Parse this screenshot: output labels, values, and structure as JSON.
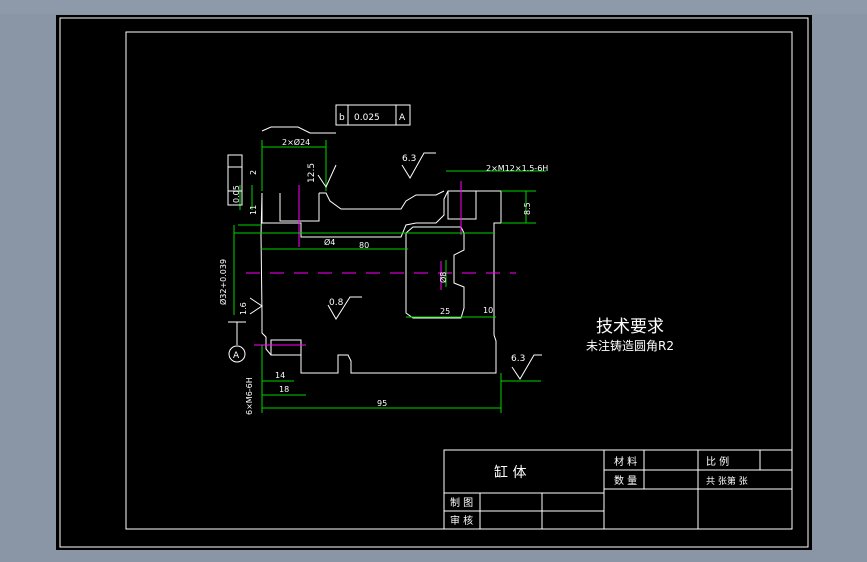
{
  "drawing": {
    "tech_title": "技术要求",
    "tech_note": "未注铸造圆角R2",
    "tolerance_frame": {
      "symbol": "b",
      "value": "0.025",
      "datum": "A"
    },
    "side_frame": {
      "symbol": "⊥",
      "value": "0.05",
      "datum": "A"
    },
    "datum_label": "A",
    "dims": {
      "holes_top_left": "2×Ø24",
      "thread_top_right": "2×M12×1.5-6H",
      "rough_1": "6.3",
      "rough_2": "12.5",
      "rough_3": "0.8",
      "rough_4": "6.3",
      "rough_5": "1.6",
      "d4": "Ø4",
      "len80": "80",
      "d8": "Ø8",
      "len25": "25",
      "len10": "10",
      "len95": "95",
      "len14": "14",
      "len18": "18",
      "h8_5": "8.5",
      "h2": "2",
      "h11": "11",
      "bore": "Ø32+0.039",
      "thread_left": "6×M6-6H"
    }
  },
  "title_block": {
    "part_name": "缸 体",
    "material_label": "材 料",
    "scale_label": "比 例",
    "qty_label": "数 量",
    "sheet_label": "共   张第   张",
    "drawn_label": "制 图",
    "checked_label": "审 核"
  }
}
